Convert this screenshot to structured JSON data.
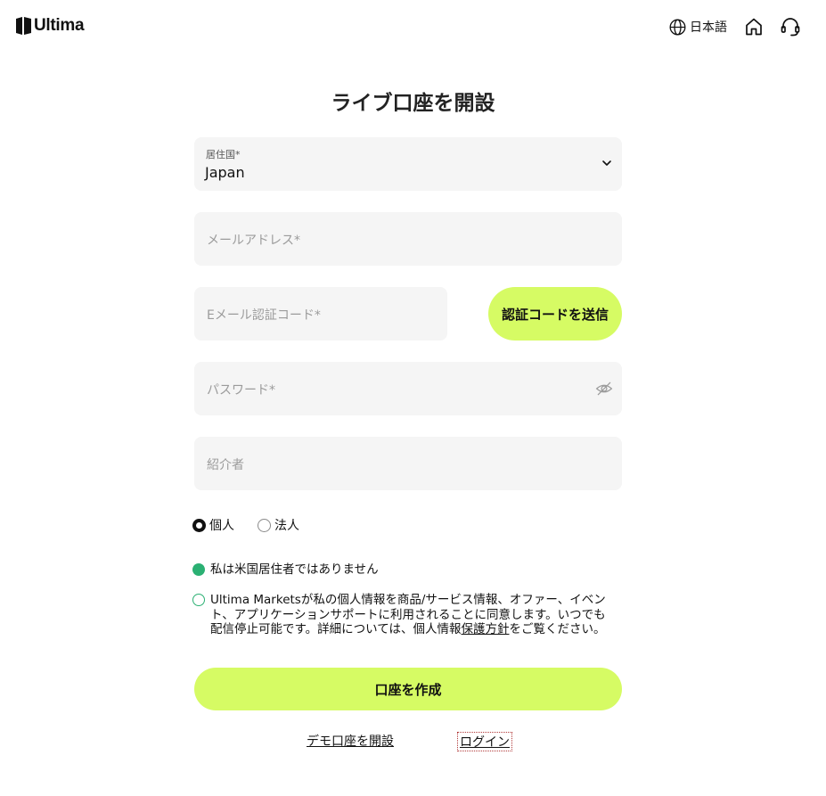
{
  "header": {
    "logo_text": "Ultima",
    "language_label": "日本語",
    "icons": [
      "globe-icon",
      "home-icon",
      "headset-icon"
    ]
  },
  "page_title": "ライブ口座を開設",
  "form": {
    "country": {
      "label": "居住国*",
      "value": "Japan"
    },
    "email_placeholder": "メールアドレス*",
    "email_code_placeholder": "Eメール認証コード*",
    "send_code_label": "認証コードを送信",
    "password_placeholder": "パスワード*",
    "referrer_placeholder": "紹介者",
    "account_type": {
      "options": [
        {
          "label": "個人",
          "selected": true
        },
        {
          "label": "法人",
          "selected": false
        }
      ]
    },
    "checks": {
      "not_us_resident": {
        "text": "私は米国居住者ではありません",
        "checked": true
      },
      "consent": {
        "text_before_link": "Ultima Marketsが私の個人情報を商品/サービス情報、オファー、イベント、アプリケーションサポートに利用されることに同意します。いつでも配信停止可能です。詳細については、個人情報",
        "link_text": "保護方針",
        "text_after_link": "をご覧ください。",
        "checked": false
      }
    },
    "submit_label": "口座を作成"
  },
  "footer_links": {
    "demo": "デモ口座を開設",
    "login": "ログイン"
  },
  "colors": {
    "accent": "#d6fb64",
    "check_green": "#2bb073",
    "field_bg": "#f5f5f5"
  }
}
